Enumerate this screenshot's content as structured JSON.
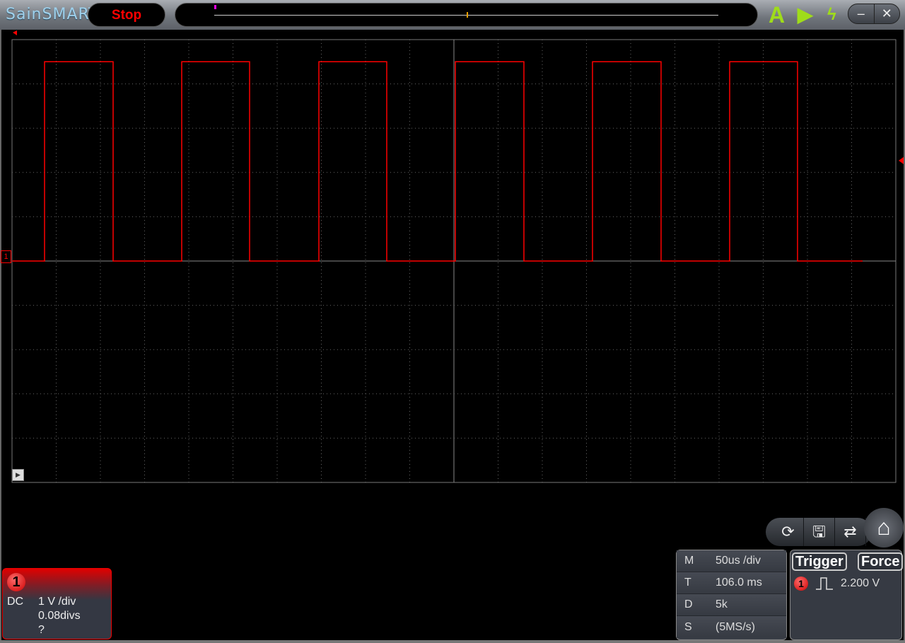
{
  "topbar": {
    "logo": "SainSMART",
    "run_state": "Stop",
    "icons": [
      "auto-icon",
      "run-icon",
      "single-trigger-icon"
    ],
    "minimize": "–",
    "close": "✕"
  },
  "trace": {
    "channel": "1",
    "color": "#ff0000",
    "high_v": 4.5,
    "low_v": 0,
    "screen_span_us": 1000,
    "edges_us": [
      36.8,
      114.4,
      192,
      268.8,
      347.2,
      424,
      501.6,
      579.2,
      656.8,
      734.4,
      812,
      888.8
    ],
    "end_us": 962.4
  },
  "toolbar": {
    "icons": [
      "auto-set-icon",
      "save-icon",
      "switch-window-icon",
      "home-icon"
    ]
  },
  "measure": {
    "rows": [
      {
        "key": "M",
        "value": "50us /div"
      },
      {
        "key": "T",
        "value": "106.0 ms"
      },
      {
        "key": "D",
        "value": "5k"
      },
      {
        "key": "S",
        "value": "(5MS/s)"
      }
    ]
  },
  "trigger": {
    "label": "Trigger",
    "force": "Force",
    "channel": "1",
    "edge": "rising",
    "level": "2.200 V"
  },
  "channel": {
    "number": "1",
    "coupling": "DC",
    "scale": "1 V /div",
    "offset": "0.08divs",
    "probe": "?"
  }
}
